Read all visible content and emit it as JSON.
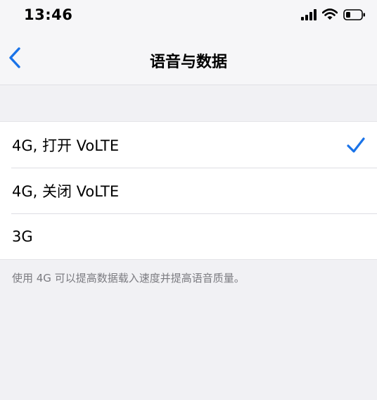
{
  "status_bar": {
    "time": "13:46",
    "signal_icon": "cellular-signal-icon",
    "wifi_icon": "wifi-icon",
    "battery_icon": "battery-icon"
  },
  "nav": {
    "title": "语音与数据",
    "back_icon": "chevron-left-icon"
  },
  "options": [
    {
      "label": "4G, 打开 VoLTE",
      "selected": true
    },
    {
      "label": "4G, 关闭 VoLTE",
      "selected": false
    },
    {
      "label": "3G",
      "selected": false
    }
  ],
  "footer": {
    "note": "使用 4G 可以提高数据载入速度并提高语音质量。"
  },
  "colors": {
    "accent": "#1a73e8",
    "background": "#f1f1f4",
    "cell_background": "#ffffff",
    "secondary_text": "#7b7b80"
  }
}
